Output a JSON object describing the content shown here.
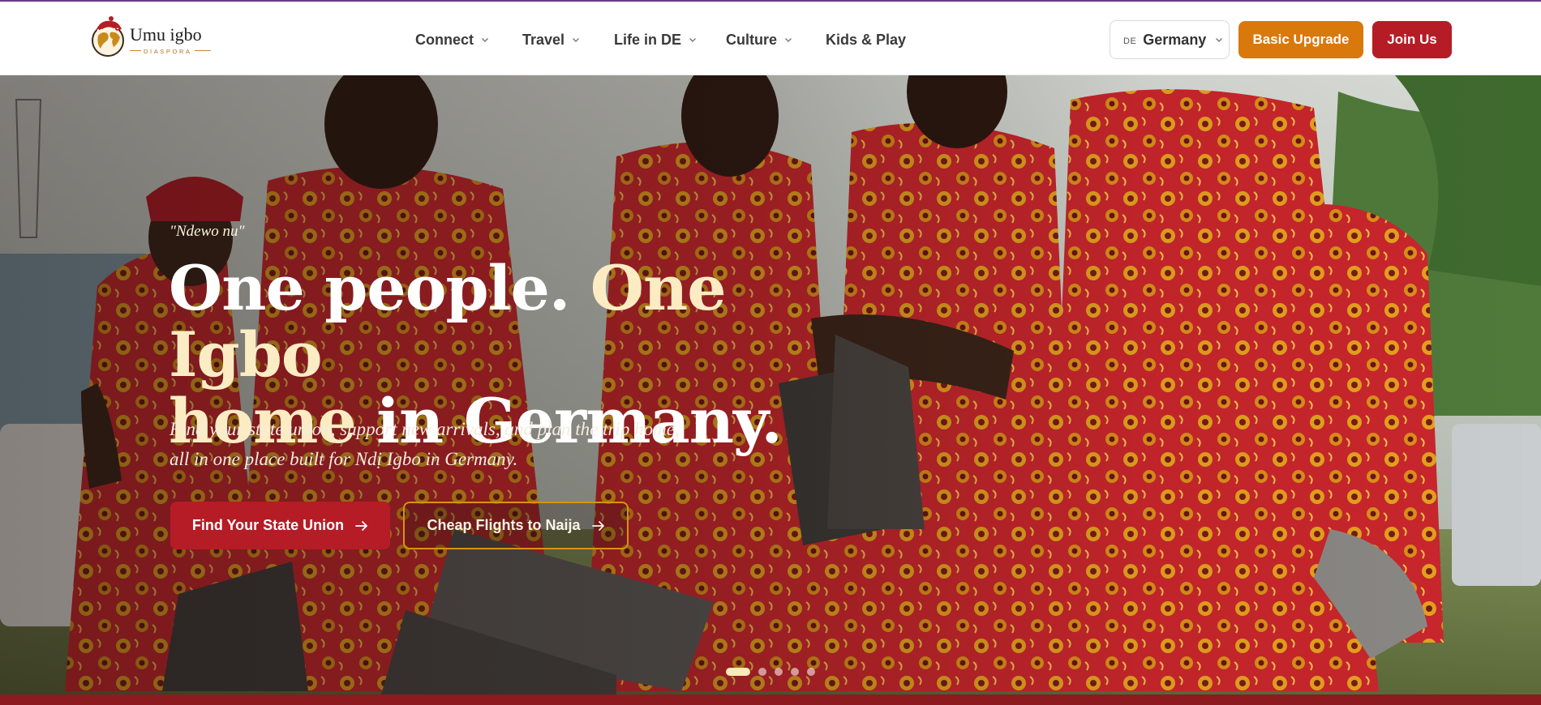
{
  "brand": {
    "name": "Umu igbo",
    "tagline": "DIASPORA"
  },
  "nav": {
    "items": [
      {
        "label": "Connect",
        "has_dropdown": true
      },
      {
        "label": "Travel",
        "has_dropdown": true
      },
      {
        "label": "Life in DE",
        "has_dropdown": true
      },
      {
        "label": "Culture",
        "has_dropdown": true
      },
      {
        "label": "Kids & Play",
        "has_dropdown": false
      }
    ]
  },
  "country_selector": {
    "code": "DE",
    "value": "Germany"
  },
  "header_buttons": {
    "upgrade": "Basic Upgrade",
    "join": "Join Us"
  },
  "hero": {
    "greeting": "\"Ndewo nu\"",
    "headline_part1": "One people. ",
    "headline_accent1": "One Igbo",
    "headline_accent2": "home",
    "headline_part2": " in Germany.",
    "subtext_line1": "Find your state union, support new arrivals, and plan the trip home,",
    "subtext_line2": "all in one place built for Ndị Igbo in Germany.",
    "cta_primary": "Find Your State Union",
    "cta_secondary": "Cheap Flights to Naija",
    "slides_total": 5,
    "active_slide": 1
  },
  "colors": {
    "brand_red": "#b51c25",
    "brand_orange": "#d9780b",
    "accent_cream": "#fbecc4",
    "band_red": "#8c1a1e"
  }
}
